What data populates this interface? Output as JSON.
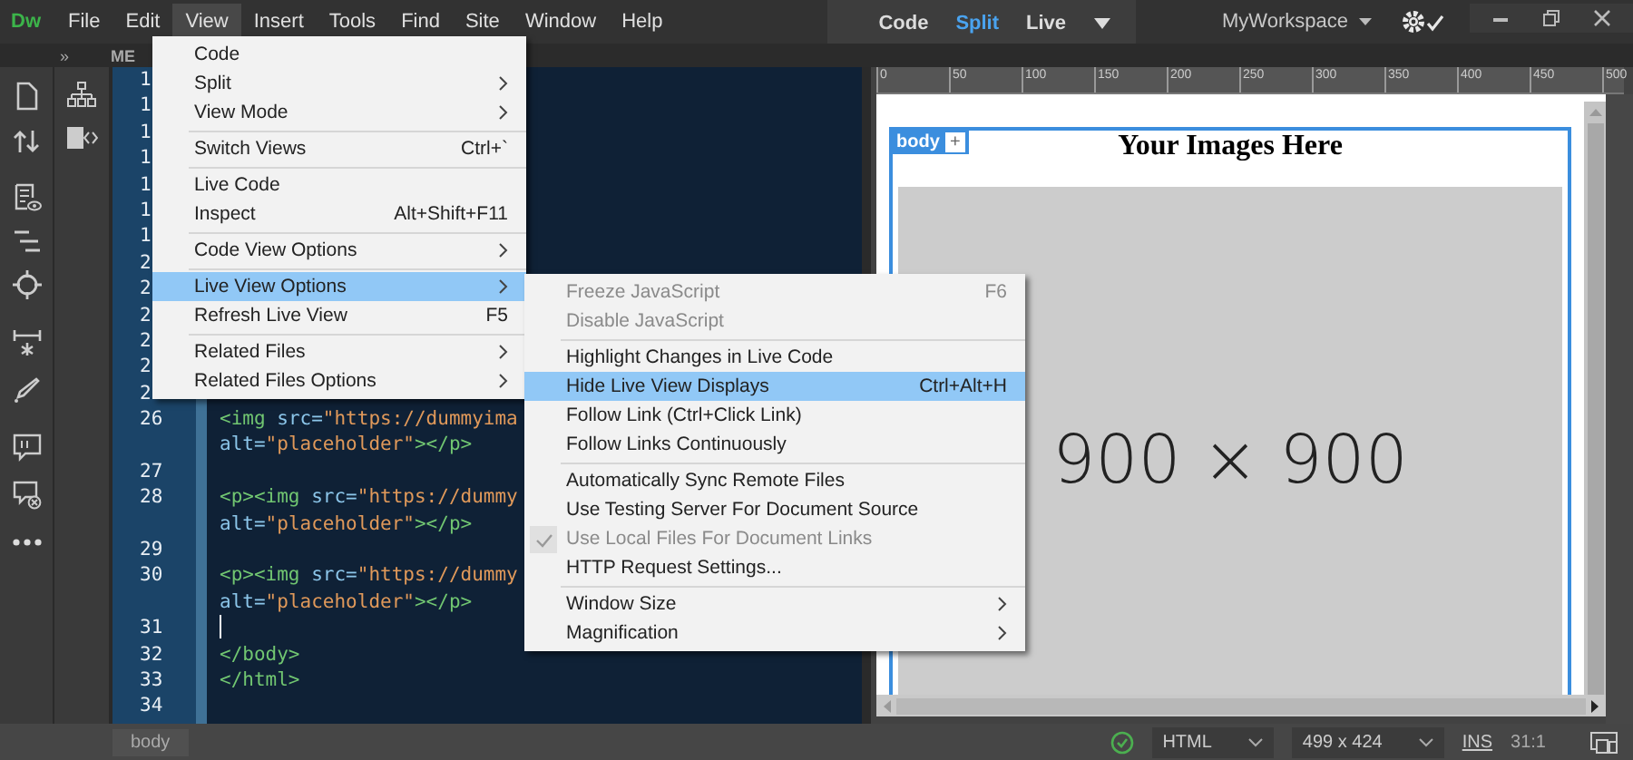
{
  "menubar": {
    "logo": "Dw",
    "items": [
      {
        "label": "File",
        "selected": false
      },
      {
        "label": "Edit",
        "selected": false
      },
      {
        "label": "View",
        "selected": true
      },
      {
        "label": "Insert",
        "selected": false
      },
      {
        "label": "Tools",
        "selected": false
      },
      {
        "label": "Find",
        "selected": false
      },
      {
        "label": "Site",
        "selected": false
      },
      {
        "label": "Window",
        "selected": false
      },
      {
        "label": "Help",
        "selected": false
      }
    ]
  },
  "view_switcher": [
    {
      "label": "Code",
      "selected": false
    },
    {
      "label": "Split",
      "selected": true
    },
    {
      "label": "Live",
      "selected": false
    }
  ],
  "workspace": "MyWorkspace",
  "panel": {
    "collapse": "»",
    "tab": "ME"
  },
  "editor": {
    "lines": [
      {
        "number": "1",
        "rows": [
          []
        ]
      },
      {
        "number": "1",
        "rows": [
          []
        ]
      },
      {
        "number": "1",
        "rows": [
          []
        ]
      },
      {
        "number": "1",
        "rows": [
          []
        ]
      },
      {
        "number": "1",
        "rows": [
          []
        ]
      },
      {
        "number": "1",
        "rows": [
          []
        ]
      },
      {
        "number": "1",
        "rows": [
          []
        ]
      },
      {
        "number": "2",
        "rows": [
          []
        ]
      },
      {
        "number": "2",
        "rows": [
          []
        ]
      },
      {
        "number": "2",
        "rows": [
          []
        ]
      },
      {
        "number": "2",
        "rows": [
          []
        ]
      },
      {
        "number": "2",
        "rows": [
          []
        ]
      },
      {
        "number": "2",
        "rows": [
          []
        ]
      },
      {
        "number": "26",
        "cursor": false,
        "rows": [
          [
            {
              "kind": "tag",
              "text": "<img"
            },
            {
              "kind": "attr",
              "text": " src="
            },
            {
              "kind": "string",
              "text": "\"https://dummyima"
            }
          ],
          [
            {
              "kind": "attr",
              "text": "alt="
            },
            {
              "kind": "string",
              "text": "\"placeholder\""
            },
            {
              "kind": "tag",
              "text": "></p>"
            }
          ]
        ]
      },
      {
        "number": "27",
        "cursor": false,
        "rows": [
          []
        ]
      },
      {
        "number": "28",
        "cursor": false,
        "rows": [
          [
            {
              "kind": "tag",
              "text": "<p><img"
            },
            {
              "kind": "attr",
              "text": " src="
            },
            {
              "kind": "string",
              "text": "\"https://dummy"
            }
          ],
          [
            {
              "kind": "attr",
              "text": "alt="
            },
            {
              "kind": "string",
              "text": "\"placeholder\""
            },
            {
              "kind": "tag",
              "text": "></p>"
            }
          ]
        ]
      },
      {
        "number": "29",
        "cursor": false,
        "rows": [
          []
        ]
      },
      {
        "number": "30",
        "cursor": false,
        "rows": [
          [
            {
              "kind": "tag",
              "text": "<p><img"
            },
            {
              "kind": "attr",
              "text": " src="
            },
            {
              "kind": "string",
              "text": "\"https://dummy"
            }
          ],
          [
            {
              "kind": "attr",
              "text": "alt="
            },
            {
              "kind": "string",
              "text": "\"placeholder\""
            },
            {
              "kind": "tag",
              "text": "></p>"
            }
          ]
        ]
      },
      {
        "number": "31",
        "cursor": true,
        "rows": [
          []
        ]
      },
      {
        "number": "32",
        "cursor": false,
        "rows": [
          [
            {
              "kind": "tag",
              "text": "</body>"
            }
          ]
        ]
      },
      {
        "number": "33",
        "cursor": false,
        "rows": [
          [
            {
              "kind": "tag",
              "text": "</html>"
            }
          ]
        ]
      },
      {
        "number": "34",
        "cursor": false,
        "rows": [
          []
        ]
      }
    ]
  },
  "view_menu": [
    {
      "kind": "item",
      "label": "Code",
      "selected": false,
      "submenu": false
    },
    {
      "kind": "item",
      "label": "Split",
      "selected": false,
      "submenu": true
    },
    {
      "kind": "item",
      "label": "View Mode",
      "selected": false,
      "submenu": true
    },
    {
      "kind": "separator"
    },
    {
      "kind": "item",
      "label": "Switch Views",
      "shortcut": "Ctrl+`",
      "selected": false,
      "submenu": false
    },
    {
      "kind": "separator"
    },
    {
      "kind": "item",
      "label": "Live Code",
      "selected": false,
      "submenu": false
    },
    {
      "kind": "item",
      "label": "Inspect",
      "shortcut": "Alt+Shift+F11",
      "selected": false,
      "submenu": false
    },
    {
      "kind": "separator"
    },
    {
      "kind": "item",
      "label": "Code View Options",
      "selected": false,
      "submenu": true
    },
    {
      "kind": "separator"
    },
    {
      "kind": "item",
      "label": "Live View Options",
      "selected": true,
      "submenu": true
    },
    {
      "kind": "item",
      "label": "Refresh Live View",
      "shortcut": "F5",
      "selected": false,
      "submenu": false
    },
    {
      "kind": "separator"
    },
    {
      "kind": "item",
      "label": "Related Files",
      "selected": false,
      "submenu": true
    },
    {
      "kind": "item",
      "label": "Related Files Options",
      "selected": false,
      "submenu": true
    }
  ],
  "live_view_options_menu": [
    {
      "kind": "item",
      "label": "Freeze JavaScript",
      "shortcut": "F6",
      "selected": false,
      "disabled": true,
      "checked": false,
      "submenu": false
    },
    {
      "kind": "item",
      "label": "Disable JavaScript",
      "selected": false,
      "disabled": true,
      "checked": false,
      "submenu": false
    },
    {
      "kind": "separator"
    },
    {
      "kind": "item",
      "label": "Highlight Changes in Live Code",
      "selected": false,
      "disabled": false,
      "checked": false,
      "submenu": false
    },
    {
      "kind": "item",
      "label": "Hide Live View Displays",
      "shortcut": "Ctrl+Alt+H",
      "selected": true,
      "disabled": false,
      "checked": false,
      "submenu": false
    },
    {
      "kind": "item",
      "label": "Follow Link (Ctrl+Click Link)",
      "selected": false,
      "disabled": false,
      "checked": false,
      "submenu": false
    },
    {
      "kind": "item",
      "label": "Follow Links Continuously",
      "selected": false,
      "disabled": false,
      "checked": false,
      "submenu": false
    },
    {
      "kind": "separator"
    },
    {
      "kind": "item",
      "label": "Automatically Sync Remote Files",
      "selected": false,
      "disabled": false,
      "checked": false,
      "submenu": false
    },
    {
      "kind": "item",
      "label": "Use Testing Server For Document Source",
      "selected": false,
      "disabled": false,
      "checked": false,
      "submenu": false
    },
    {
      "kind": "item",
      "label": "Use Local Files For Document Links",
      "selected": false,
      "disabled": true,
      "checked": true,
      "submenu": false
    },
    {
      "kind": "item",
      "label": "HTTP Request Settings...",
      "selected": false,
      "disabled": false,
      "checked": false,
      "submenu": false
    },
    {
      "kind": "separator"
    },
    {
      "kind": "item",
      "label": "Window Size",
      "selected": false,
      "disabled": false,
      "checked": false,
      "submenu": true
    },
    {
      "kind": "item",
      "label": "Magnification",
      "selected": false,
      "disabled": false,
      "checked": false,
      "submenu": true
    }
  ],
  "live_view": {
    "ruler_ticks": [
      "0",
      "50",
      "100",
      "150",
      "200",
      "250",
      "300",
      "350",
      "400",
      "450",
      "500"
    ],
    "element_tag": "body",
    "add_button": "+",
    "heading": "Your Images Here",
    "placeholder_label": "900 × 900"
  },
  "status_bar": {
    "breadcrumb": "body",
    "language": "HTML",
    "size": "499 x 424",
    "mode": "INS",
    "position": "31:1"
  }
}
